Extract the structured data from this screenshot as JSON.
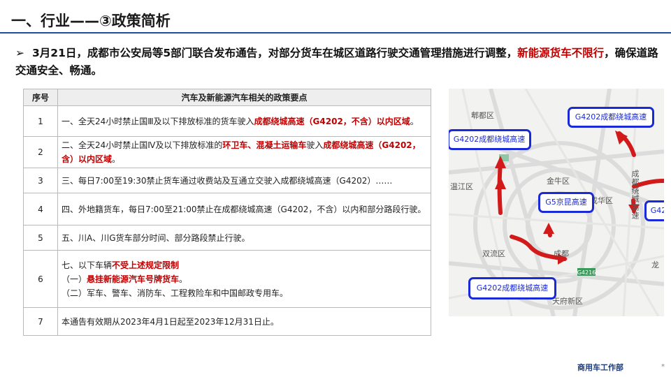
{
  "header": {
    "title": "一、行业——③政策简析"
  },
  "bullet": {
    "arrow": "➢",
    "text_before": "3月21日，成都市公安局等5部门联合发布通告，对部分货车在城区道路行驶交通管理措施进行调整，",
    "text_highlight": "新能源货车不限行",
    "text_after": "，确保道路交通安全、畅通。"
  },
  "table": {
    "headers": [
      "序号",
      "汽车及新能源汽车相关的政策要点"
    ],
    "rows": [
      {
        "no": "1",
        "parts": [
          {
            "t": "一、全天24小时禁止国Ⅲ及以下排放标准的货车驶入"
          },
          {
            "t": "成都绕城高速（G4202，不含）以内区域",
            "red": true
          },
          {
            "t": "。"
          }
        ]
      },
      {
        "no": "2",
        "parts": [
          {
            "t": "二、全天24小时禁止国Ⅳ及以下排放标准的"
          },
          {
            "t": "环卫车、混凝土运输车",
            "red": true
          },
          {
            "t": "驶入"
          },
          {
            "t": "成都绕城高速（G4202，含）以内区域",
            "red": true
          },
          {
            "t": "。"
          }
        ]
      },
      {
        "no": "3",
        "parts": [
          {
            "t": "三、每日7:00至19:30禁止货车通过收费站及互通立交驶入成都绕城高速（G4202）……"
          }
        ]
      },
      {
        "no": "4",
        "parts": [
          {
            "t": "四、外地籍货车，每日7:00至21:00禁止在成都绕城高速（G4202，不含）以内和部分路段行驶。"
          }
        ]
      },
      {
        "no": "5",
        "parts": [
          {
            "t": "五、川A、川G货车部分时间、部分路段禁止行驶。"
          }
        ]
      },
      {
        "no": "6",
        "lines": [
          [
            {
              "t": "七、以下车辆"
            },
            {
              "t": "不受上述规定限制",
              "red": true
            }
          ],
          [
            {
              "t": "（一）"
            },
            {
              "t": "悬挂新能源汽车号牌货车",
              "red": true
            },
            {
              "t": "。"
            }
          ],
          [
            {
              "t": "（二）军车、警车、消防车、工程救险车和中国邮政专用车。"
            }
          ]
        ]
      },
      {
        "no": "7",
        "parts": [
          {
            "t": "本通告有效期从2023年4月1日起至2023年12月31日止。"
          }
        ]
      }
    ]
  },
  "map": {
    "labels": {
      "pidu": "郫都区",
      "wenjiang": "温江区",
      "jinniu": "金牛区",
      "chenghua": "成华区",
      "shuangliu": "双流区",
      "chengdu": "成都",
      "tianfu": "天府新区",
      "longquan": "龙",
      "east_hw": "成都绕城高速"
    },
    "highways": {
      "top_right": "G4202成都绕城高速",
      "left": "G4202成都绕城高速",
      "center": "G5京昆高速",
      "right_edge": "G42",
      "bottom": "G4202成都绕城高速",
      "shield": "G4216",
      "shield_left": "G4202"
    },
    "road_color": "#d21a1a",
    "box_color": "#1a2ad6"
  },
  "footer": {
    "dept": "商用车工作部",
    "page": "*"
  }
}
